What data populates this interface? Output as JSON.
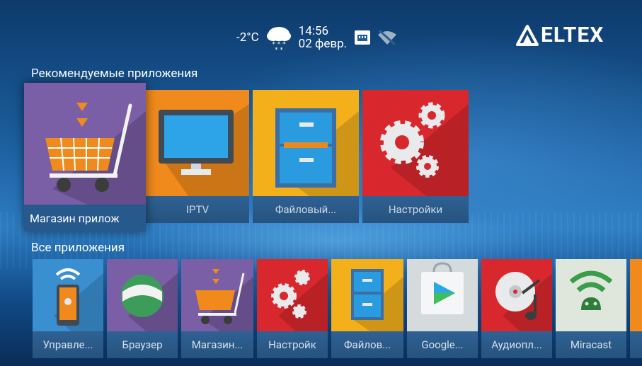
{
  "status_bar": {
    "temperature": "-2°C",
    "time": "14:56",
    "date": "02 февр.",
    "weather_icon": "cloud-snow-icon",
    "network_icon": "ethernet-icon",
    "wifi_icon": "wifi-off-icon"
  },
  "brand": {
    "name": "ELTEX"
  },
  "featured": {
    "title": "Рекомендуемые приложения",
    "items": [
      {
        "label": "Магазин прилож",
        "icon": "shopping-cart-icon",
        "color": "#7b5fa6"
      },
      {
        "label": "IPTV",
        "icon": "monitor-icon",
        "color": "#f08a1c"
      },
      {
        "label": "Файловый...",
        "icon": "file-cabinet-icon",
        "color": "#f3b01a"
      },
      {
        "label": "Настройки",
        "icon": "gears-icon",
        "color": "#d9282d"
      }
    ]
  },
  "all_apps": {
    "title": "Все приложения",
    "items": [
      {
        "label": "Управле...",
        "icon": "remote-control-icon",
        "color": "#3a8fd0"
      },
      {
        "label": "Браузер",
        "icon": "globe-icon",
        "color": "#7b5fa6"
      },
      {
        "label": "Магазин...",
        "icon": "shopping-cart-icon",
        "color": "#7b5fa6"
      },
      {
        "label": "Настройк",
        "icon": "gears-icon",
        "color": "#d9282d"
      },
      {
        "label": "Файлов...",
        "icon": "file-cabinet-icon",
        "color": "#f3b01a"
      },
      {
        "label": "Google...",
        "icon": "play-store-icon",
        "color": "#dfe3e6"
      },
      {
        "label": "Аудиопл...",
        "icon": "audio-disc-icon",
        "color": "#d9282d"
      },
      {
        "label": "Miracast",
        "icon": "android-wifi-icon",
        "color": "#dfe7dd"
      }
    ]
  }
}
